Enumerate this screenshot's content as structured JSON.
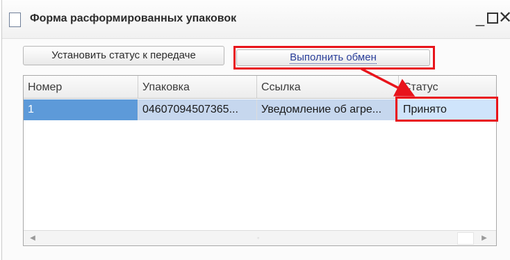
{
  "window": {
    "title": "Форма расформированных упаковок",
    "min_glyph": "_",
    "close_glyph": "✕"
  },
  "toolbar": {
    "set_status_label": "Установить статус к передаче",
    "exchange_label": "Выполнить обмен"
  },
  "table": {
    "columns": [
      "Номер",
      "Упаковка",
      "Ссылка",
      "Статус"
    ],
    "rows": [
      {
        "number": "1",
        "package": "04607094507365...",
        "link": "Уведомление об агре...",
        "status": "Принято"
      }
    ]
  },
  "annotation": {
    "color": "#e8141b"
  },
  "scrollbar": {
    "left_icon": "◀",
    "right_icon": "▶"
  }
}
